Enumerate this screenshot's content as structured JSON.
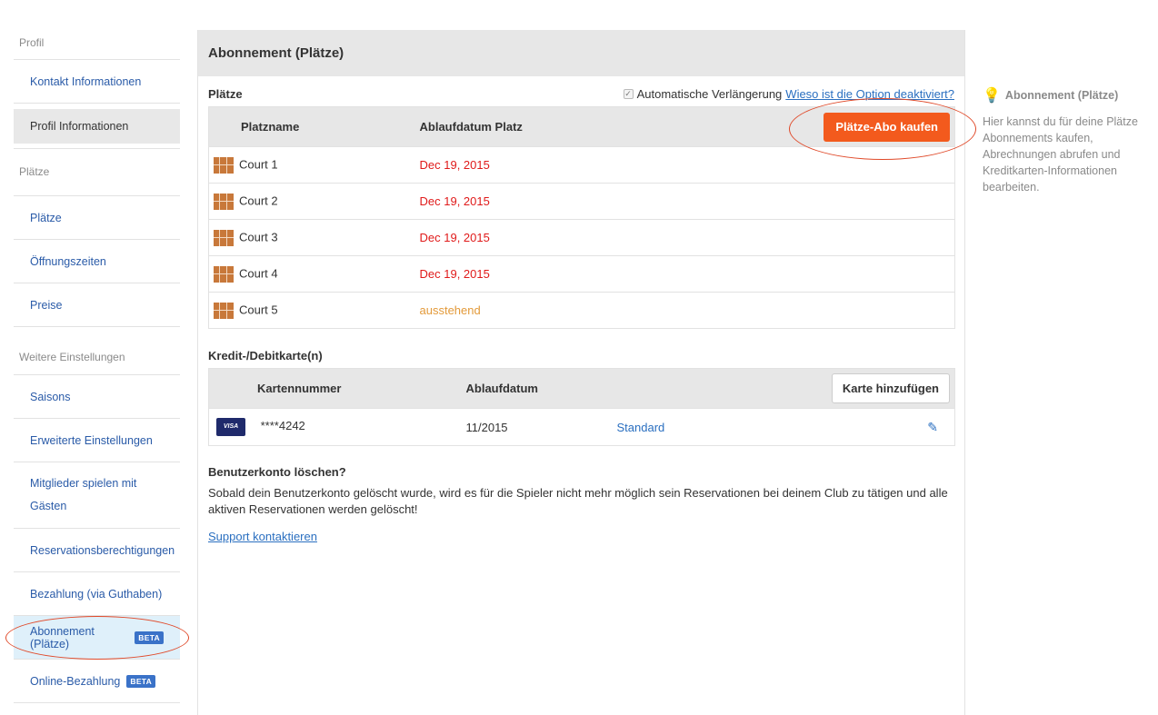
{
  "sidebar": {
    "sections": [
      {
        "title": "Profil",
        "items": [
          {
            "label": "Kontakt Informationen"
          },
          {
            "label": "Profil Informationen"
          }
        ]
      },
      {
        "title": "Plätze",
        "items": [
          {
            "label": "Plätze"
          },
          {
            "label": "Öffnungszeiten"
          },
          {
            "label": "Preise"
          }
        ]
      },
      {
        "title": "Weitere Einstellungen",
        "items": [
          {
            "label": "Saisons"
          },
          {
            "label": "Erweiterte Einstellungen"
          },
          {
            "label": "Mitglieder spielen mit Gästen"
          },
          {
            "label": "Reservationsberechtigungen"
          },
          {
            "label": "Bezahlung (via Guthaben)"
          },
          {
            "label": "Abonnement (Plätze)",
            "badge": "BETA"
          },
          {
            "label": "Online-Bezahlung",
            "badge": "BETA"
          }
        ]
      }
    ]
  },
  "main": {
    "title": "Abonnement (Plätze)",
    "courts_section": {
      "title": "Plätze",
      "auto_renew_label": "Automatische Verlängerung",
      "auto_renew_checked": true,
      "why_link": "Wieso ist die Option deaktiviert?",
      "columns": [
        "Platzname",
        "Ablaufdatum Platz"
      ],
      "buy_button": "Plätze-Abo kaufen",
      "rows": [
        {
          "name": "Court 1",
          "expiry": "Dec 19, 2015",
          "status": "expired"
        },
        {
          "name": "Court 2",
          "expiry": "Dec 19, 2015",
          "status": "expired"
        },
        {
          "name": "Court 3",
          "expiry": "Dec 19, 2015",
          "status": "expired"
        },
        {
          "name": "Court 4",
          "expiry": "Dec 19, 2015",
          "status": "expired"
        },
        {
          "name": "Court 5",
          "expiry": "ausstehend",
          "status": "pending"
        }
      ]
    },
    "cards_section": {
      "title": "Kredit-/Debitkarte(n)",
      "columns": [
        "Kartennummer",
        "Ablaufdatum"
      ],
      "add_button": "Karte hinzufügen",
      "rows": [
        {
          "brand": "VISA",
          "number": "****4242",
          "expiry": "11/2015",
          "default_label": "Standard"
        }
      ]
    },
    "delete_section": {
      "title": "Benutzerkonto löschen?",
      "text": "Sobald dein Benutzerkonto gelöscht wurde, wird es für die Spieler nicht mehr möglich sein Reservationen bei deinem Club zu tätigen und alle aktiven Reservationen werden gelöscht!",
      "support_link": "Support kontaktieren"
    }
  },
  "help": {
    "title": "Abonnement (Plätze)",
    "text": "Hier kannst du für deine Plätze Abonnements kaufen, Abrechnungen abrufen und Kreditkarten-Informationen bearbeiten."
  },
  "colors": {
    "accent": "#f35a1d",
    "link": "#2a6fc0",
    "expired": "#e01a1a",
    "pending": "#e39a3a",
    "annotation": "#e04a2a"
  }
}
